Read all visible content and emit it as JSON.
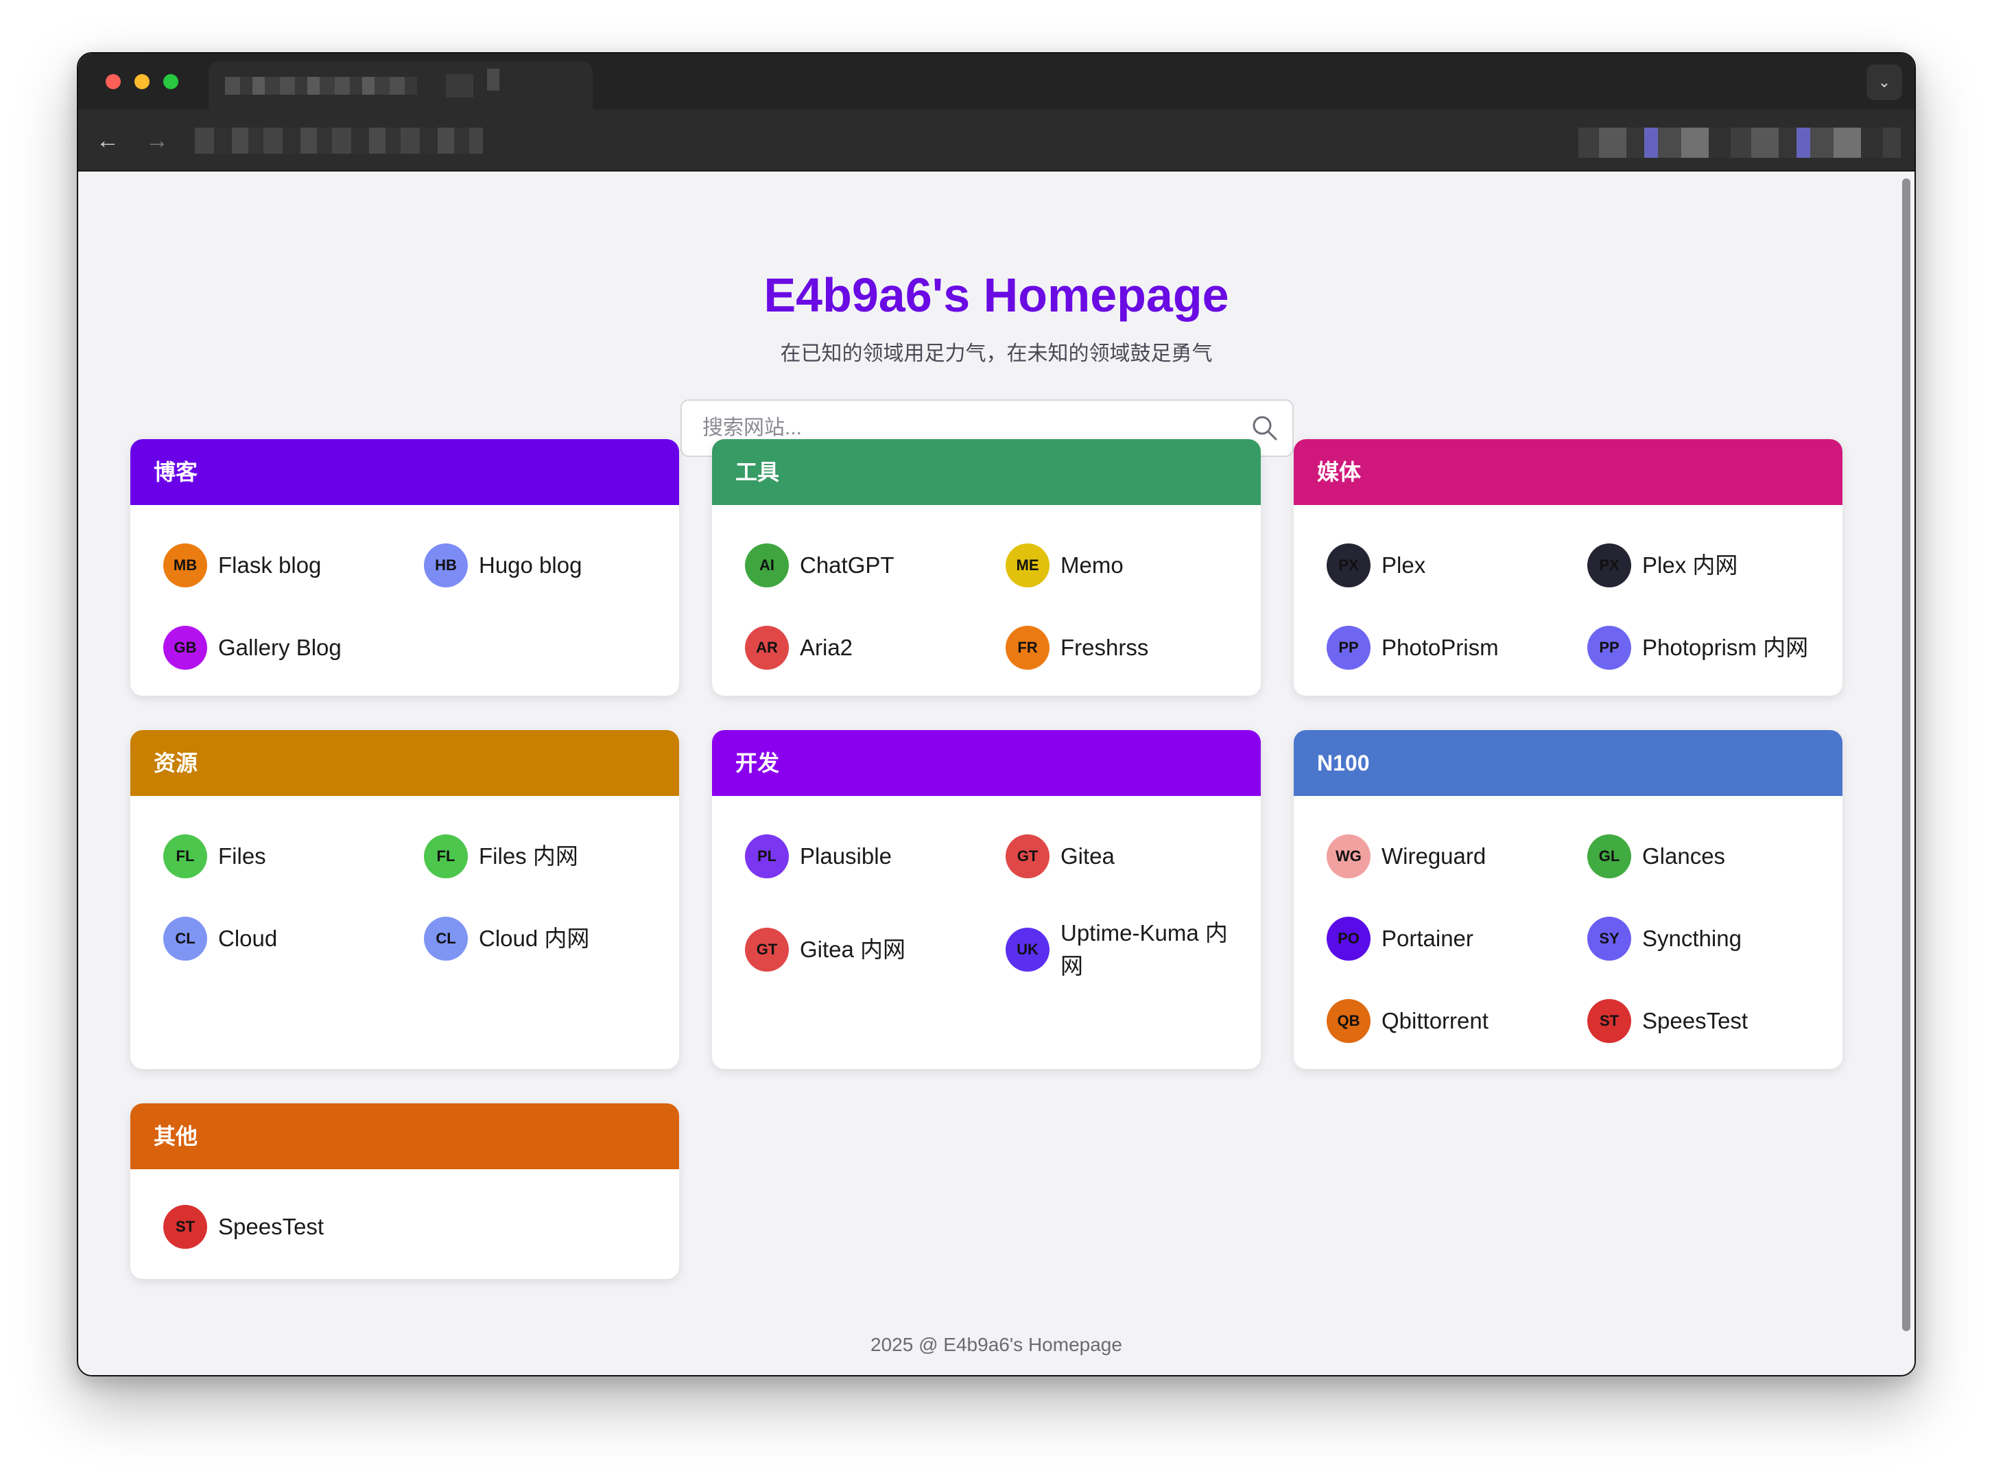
{
  "site": {
    "title": "E4b9a6's Homepage",
    "subtitle": "在已知的领域用足力气，在未知的领域鼓足勇气",
    "footer": "2025 @ E4b9a6's Homepage"
  },
  "search": {
    "placeholder": "搜索网站..."
  },
  "colors": {
    "title": "#6a0be3",
    "blog": "#6a00e8",
    "tools": "#379b65",
    "media": "#d0187c",
    "resources": "#c97f00",
    "dev": "#8a00ee",
    "n100": "#4a76cc",
    "other": "#d9620d"
  },
  "categories": [
    {
      "title": "博客",
      "links": [
        {
          "initials": "MB",
          "label": "Flask blog",
          "color": "#ea7c10"
        },
        {
          "initials": "HB",
          "label": "Hugo blog",
          "color": "#7c8cf5"
        },
        {
          "initials": "GB",
          "label": "Gallery Blog",
          "color": "#b312ef"
        }
      ]
    },
    {
      "title": "工具",
      "links": [
        {
          "initials": "AI",
          "label": "ChatGPT",
          "color": "#3fa63f"
        },
        {
          "initials": "ME",
          "label": "Memo",
          "color": "#e2c10c"
        },
        {
          "initials": "AR",
          "label": "Aria2",
          "color": "#e04848"
        },
        {
          "initials": "FR",
          "label": "Freshrss",
          "color": "#ec7a12"
        }
      ]
    },
    {
      "title": "媒体",
      "links": [
        {
          "initials": "PX",
          "label": "Plex",
          "color": "#242433"
        },
        {
          "initials": "PX",
          "label": "Plex 内网",
          "color": "#242433"
        },
        {
          "initials": "PP",
          "label": "PhotoPrism",
          "color": "#6e66f2"
        },
        {
          "initials": "PP",
          "label": "Photoprism 内网",
          "color": "#6e66f2"
        }
      ]
    },
    {
      "title": "资源",
      "links": [
        {
          "initials": "FL",
          "label": "Files",
          "color": "#4cc64c"
        },
        {
          "initials": "FL",
          "label": "Files 内网",
          "color": "#4cc64c"
        },
        {
          "initials": "CL",
          "label": "Cloud",
          "color": "#7e95f4"
        },
        {
          "initials": "CL",
          "label": "Cloud 内网",
          "color": "#7e95f4"
        }
      ]
    },
    {
      "title": "开发",
      "links": [
        {
          "initials": "PL",
          "label": "Plausible",
          "color": "#7b36f2"
        },
        {
          "initials": "GT",
          "label": "Gitea",
          "color": "#e04848"
        },
        {
          "initials": "GT",
          "label": "Gitea 内网",
          "color": "#e04848"
        },
        {
          "initials": "UK",
          "label": "Uptime-Kuma 内网",
          "color": "#5b2ff0"
        }
      ]
    },
    {
      "title": "N100",
      "links": [
        {
          "initials": "WG",
          "label": "Wireguard",
          "color": "#f2a1a1"
        },
        {
          "initials": "GL",
          "label": "Glances",
          "color": "#40ab40"
        },
        {
          "initials": "PO",
          "label": "Portainer",
          "color": "#5a0ce8"
        },
        {
          "initials": "SY",
          "label": "Syncthing",
          "color": "#6a5ef2"
        },
        {
          "initials": "QB",
          "label": "Qbittorrent",
          "color": "#e06a10"
        },
        {
          "initials": "ST",
          "label": "SpeesTest",
          "color": "#d93030"
        }
      ]
    },
    {
      "title": "其他",
      "links": [
        {
          "initials": "ST",
          "label": "SpeesTest",
          "color": "#d93030"
        }
      ]
    }
  ]
}
